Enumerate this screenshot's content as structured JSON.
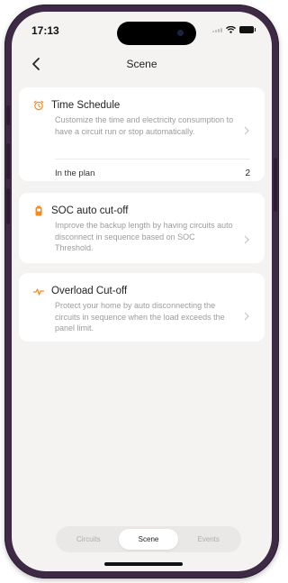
{
  "status_bar": {
    "time": "17:13"
  },
  "nav": {
    "title": "Scene"
  },
  "cards": [
    {
      "icon": "alarm-clock-icon",
      "title": "Time Schedule",
      "description": "Customize the time and electricity consumption to have a circuit run or stop automatically.",
      "plan_label": "In the plan",
      "plan_count": "2"
    },
    {
      "icon": "battery-icon",
      "title": "SOC auto cut-off",
      "description": "Improve the backup length by having circuits auto disconnect in sequence based on SOC Threshold."
    },
    {
      "icon": "pulse-icon",
      "title": "Overload Cut-off",
      "description": "Protect your home by auto disconnecting the circuits in sequence when the load exceeds the panel limit."
    }
  ],
  "tabs": [
    {
      "label": "Circuits",
      "active": false
    },
    {
      "label": "Scene",
      "active": true
    },
    {
      "label": "Events",
      "active": false
    }
  ],
  "colors": {
    "accent": "#f28a22",
    "frame": "#3f2a46",
    "screen_bg": "#f4f3f1"
  }
}
